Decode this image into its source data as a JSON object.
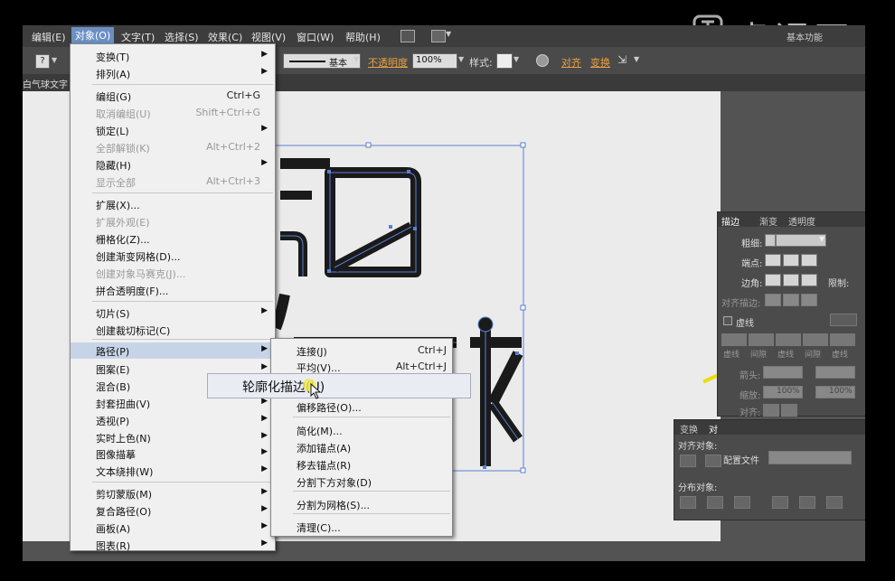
{
  "watermark": "虎课网",
  "menubar": {
    "items": [
      "编辑(E)",
      "对象(O)",
      "文字(T)",
      "选择(S)",
      "效果(C)",
      "视图(V)",
      "窗口(W)",
      "帮助(H)"
    ],
    "workspace": "基本功能"
  },
  "control_bar": {
    "stroke_style": "基本",
    "opacity_label": "不透明度",
    "opacity_value": "100%",
    "style_label": "样式:",
    "align_label": "对齐",
    "transform_label": "变换"
  },
  "document_tab": "白气球文字",
  "object_menu": {
    "items": [
      {
        "label": "变换(T)",
        "submenu": true
      },
      {
        "label": "排列(A)",
        "submenu": true
      },
      {
        "label": "编组(G)",
        "shortcut": "Ctrl+G"
      },
      {
        "label": "取消编组(U)",
        "shortcut": "Shift+Ctrl+G",
        "disabled": true
      },
      {
        "label": "锁定(L)",
        "submenu": true
      },
      {
        "label": "全部解锁(K)",
        "shortcut": "Alt+Ctrl+2",
        "disabled": true
      },
      {
        "label": "隐藏(H)",
        "submenu": true
      },
      {
        "label": "显示全部",
        "shortcut": "Alt+Ctrl+3",
        "disabled": true
      },
      {
        "label": "扩展(X)..."
      },
      {
        "label": "扩展外观(E)",
        "disabled": true
      },
      {
        "label": "栅格化(Z)..."
      },
      {
        "label": "创建渐变网格(D)..."
      },
      {
        "label": "创建对象马赛克(J)...",
        "disabled": true
      },
      {
        "label": "拼合透明度(F)..."
      },
      {
        "label": "切片(S)",
        "submenu": true
      },
      {
        "label": "创建裁切标记(C)"
      },
      {
        "label": "路径(P)",
        "submenu": true,
        "highlighted": true
      },
      {
        "label": "图案(E)",
        "submenu": true
      },
      {
        "label": "混合(B)",
        "submenu": true
      },
      {
        "label": "封套扭曲(V)",
        "submenu": true
      },
      {
        "label": "透视(P)",
        "submenu": true
      },
      {
        "label": "实时上色(N)",
        "submenu": true
      },
      {
        "label": "图像描摹",
        "submenu": true
      },
      {
        "label": "文本绕排(W)",
        "submenu": true
      },
      {
        "label": "剪切蒙版(M)",
        "submenu": true
      },
      {
        "label": "复合路径(O)",
        "submenu": true
      },
      {
        "label": "画板(A)",
        "submenu": true
      },
      {
        "label": "图表(R)",
        "submenu": true
      }
    ]
  },
  "path_submenu": {
    "items": [
      {
        "label": "连接(J)",
        "shortcut": "Ctrl+J"
      },
      {
        "label": "平均(V)...",
        "shortcut": "Alt+Ctrl+J"
      },
      {
        "label": "轮廓化描边(U)",
        "highlighted": true
      },
      {
        "label": "偏移路径(O)..."
      },
      {
        "label": "简化(M)..."
      },
      {
        "label": "添加锚点(A)"
      },
      {
        "label": "移去锚点(R)"
      },
      {
        "label": "分割下方对象(D)"
      },
      {
        "label": "分割为网格(S)..."
      },
      {
        "label": "清理(C)..."
      }
    ]
  },
  "hover_tooltip": "轮廓化描边(U)",
  "stroke_panel": {
    "tabs": [
      "描边",
      "渐变",
      "透明度"
    ],
    "weight_label": "粗细:",
    "cap_label": "端点:",
    "corner_label": "边角:",
    "limit_label": "限制:",
    "align_stroke_label": "对齐描边:",
    "dashed_label": "虚线",
    "dash_fields": [
      "虚线",
      "间隙",
      "虚线",
      "间隙",
      "虚线"
    ],
    "arrow_label": "箭头:",
    "scale_label": "缩放:",
    "scale_values": [
      "100%",
      "100%"
    ],
    "align_label": "对齐:"
  },
  "align_panel": {
    "tabs": [
      "变换",
      "对"
    ],
    "align_objects_label": "对齐对象:",
    "profile_label": "配置文件",
    "distribute_label": "分布对象:"
  },
  "colors": {
    "menu_bg": "#f0f0f0",
    "menu_highlight": "#c7d4e8",
    "selection_blue": "#5a7fd6",
    "glyph_fill": "#1a1a1a",
    "accent_yellow": "#e8e000"
  }
}
